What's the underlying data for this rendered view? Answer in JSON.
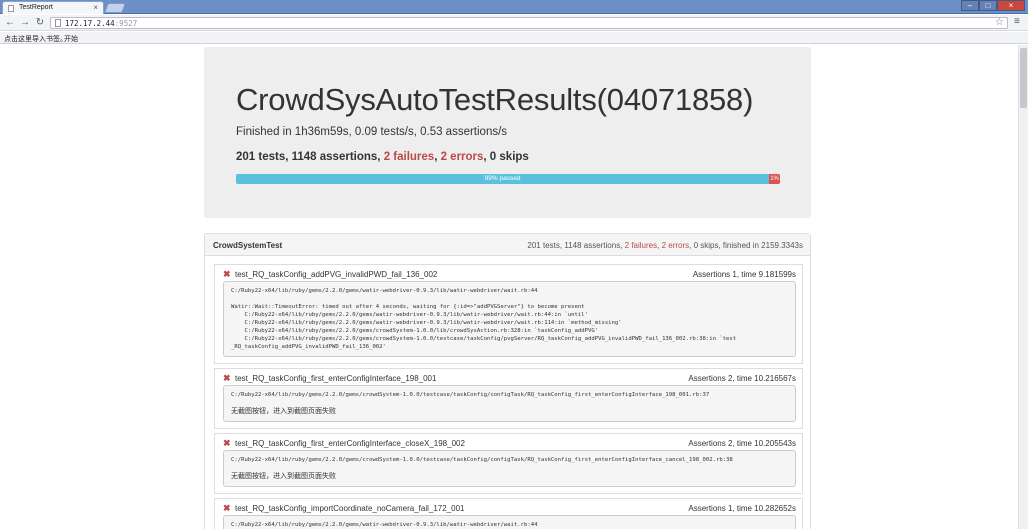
{
  "browser": {
    "tab_title": "TestReport",
    "url_host": "172.17.2.44",
    "url_port": ":9527",
    "bookmarks": [
      "点击这里导入书签。",
      "开始"
    ]
  },
  "report": {
    "title": "CrowdSysAutoTestResults(04071858)",
    "finished": "Finished in 1h36m59s, 0.09 tests/s, 0.53 assertions/s",
    "stats": {
      "tests": "201 tests, 1148 assertions, ",
      "failures": "2 failures",
      "sep1": ", ",
      "errors": "2 errors",
      "tail": ", 0 skips"
    },
    "progress": {
      "passed_label": "99% passed",
      "pass_fraction": 0.98,
      "fail_label": "1%"
    }
  },
  "suite": {
    "name": "CrowdSystemTest",
    "summary": {
      "head": "201 tests, 1148 assertions, ",
      "failures": "2 failures",
      "sep": ", ",
      "errors": "2 errors",
      "tail": ", 0 skips, finished in 2159.3343s"
    }
  },
  "tests": [
    {
      "name": "test_RQ_taskConfig_addPVG_invalidPWD_fail_136_002",
      "meta": "Assertions 1, time 9.181599s",
      "log": "C:/Ruby22-x64/lib/ruby/gems/2.2.0/gems/watir-webdriver-0.9.3/lib/watir-webdriver/wait.rb:44\n\nWatir::Wait::TimeoutError: timed out after 4 seconds, waiting for {:id=>\"addPVGServer\"} to become present\n    C:/Ruby22-x64/lib/ruby/gems/2.2.0/gems/watir-webdriver-0.9.3/lib/watir-webdriver/wait.rb:44:in `until'\n    C:/Ruby22-x64/lib/ruby/gems/2.2.0/gems/watir-webdriver-0.9.3/lib/watir-webdriver/wait.rb:114:in `method_missing'\n    C:/Ruby22-x64/lib/ruby/gems/2.2.0/gems/crowdSystem-1.0.0/lib/crowdSysAction.rb:328:in `taskConfig_addPVG'\n    C:/Ruby22-x64/lib/ruby/gems/2.2.0/gems/crowdSystem-1.0.0/testcase/taskConfig/pvgServer/RQ_taskConfig_addPVG_invalidPWD_fail_136_002.rb:38:in `test\n_RQ_taskConfig_addPVG_invalidPWD_fail_136_002'"
    },
    {
      "name": "test_RQ_taskConfig_first_enterConfigInterface_198_001",
      "meta": "Assertions 2, time 10.216567s",
      "log": "C:/Ruby22-x64/lib/ruby/gems/2.2.0/gems/crowdSystem-1.0.0/testcase/taskConfig/configTask/RQ_taskConfig_first_enterConfigInterface_198_001.rb:37",
      "note": "无截图按钮，进入到截图页面失败"
    },
    {
      "name": "test_RQ_taskConfig_first_enterConfigInterface_closeX_198_002",
      "meta": "Assertions 2, time 10.205543s",
      "log": "C:/Ruby22-x64/lib/ruby/gems/2.2.0/gems/crowdSystem-1.0.0/testcase/taskConfig/configTask/RQ_taskConfig_first_enterConfigInterface_cancel_198_002.rb:38",
      "note": "无截图按钮，进入到截图页面失败"
    },
    {
      "name": "test_RQ_taskConfig_importCoordinate_noCamera_fail_172_001",
      "meta": "Assertions 1, time 10.282652s",
      "log": "C:/Ruby22-x64/lib/ruby/gems/2.2.0/gems/watir-webdriver-0.9.3/lib/watir-webdriver/wait.rb:44"
    }
  ],
  "colors": {
    "failure": "#b94a48",
    "progress": "#5bc0de",
    "progress_fail": "#d9534f"
  }
}
